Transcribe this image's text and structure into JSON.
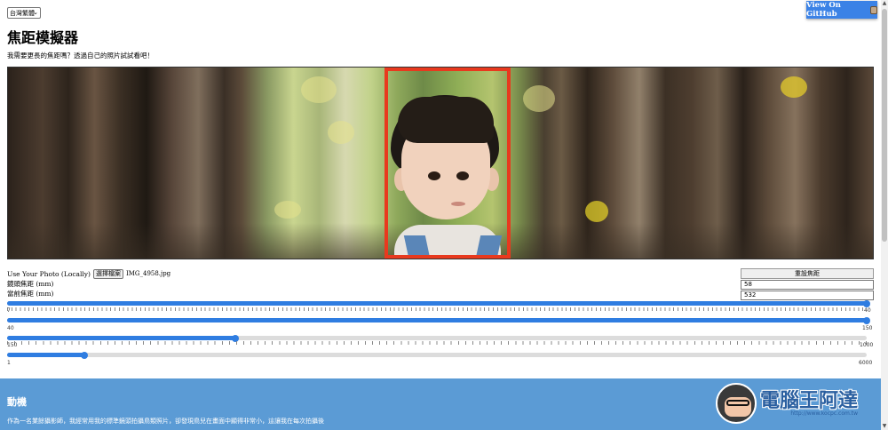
{
  "language_select": {
    "value": "台灣繁體"
  },
  "github_button": {
    "label": "View On GitHub",
    "icon": "github-icon"
  },
  "header": {
    "title": "焦距模擬器",
    "subtitle": "我需要更長的焦距嗎？透過自己的照片試試看吧！"
  },
  "file_input": {
    "label": "Use Your Photo (Locally)",
    "button_label": "選擇檔案",
    "file_name": "IMG_4958.jpg"
  },
  "focal_labels": {
    "lens": "鏡頭焦距 (mm)",
    "current": "當前焦距 (mm)"
  },
  "reset_button": {
    "label": "重設焦距"
  },
  "fields": {
    "lens_focal": "58",
    "current_focal": "532"
  },
  "sliders": [
    {
      "name": "lens-focal-slider",
      "min_label": "7",
      "max_label": "40",
      "fraction": 1.0
    },
    {
      "name": "lens-range-slider",
      "min_label": "40",
      "max_label": "150",
      "fraction": 1.0
    },
    {
      "name": "current-focal-slider",
      "min_label": "150",
      "max_label": "1000",
      "fraction": 0.265
    },
    {
      "name": "extended-focal-slider",
      "min_label": "1",
      "max_label": "6000",
      "fraction": 0.09
    }
  ],
  "motive": {
    "heading": "動機",
    "body": "作為一名業餘攝影師，我經常用我的標準鏡頭拍攝鳥類照片，卻發現鳥兒在畫面中顯得非常小，這讓我在每次拍攝後"
  },
  "watermark": {
    "text": "電腦王阿達",
    "url": "http://www.kocpc.com.tw"
  },
  "colors": {
    "accent": "#2f7de1",
    "frame": "#e8391e",
    "section_bg": "#5b9bd5"
  }
}
